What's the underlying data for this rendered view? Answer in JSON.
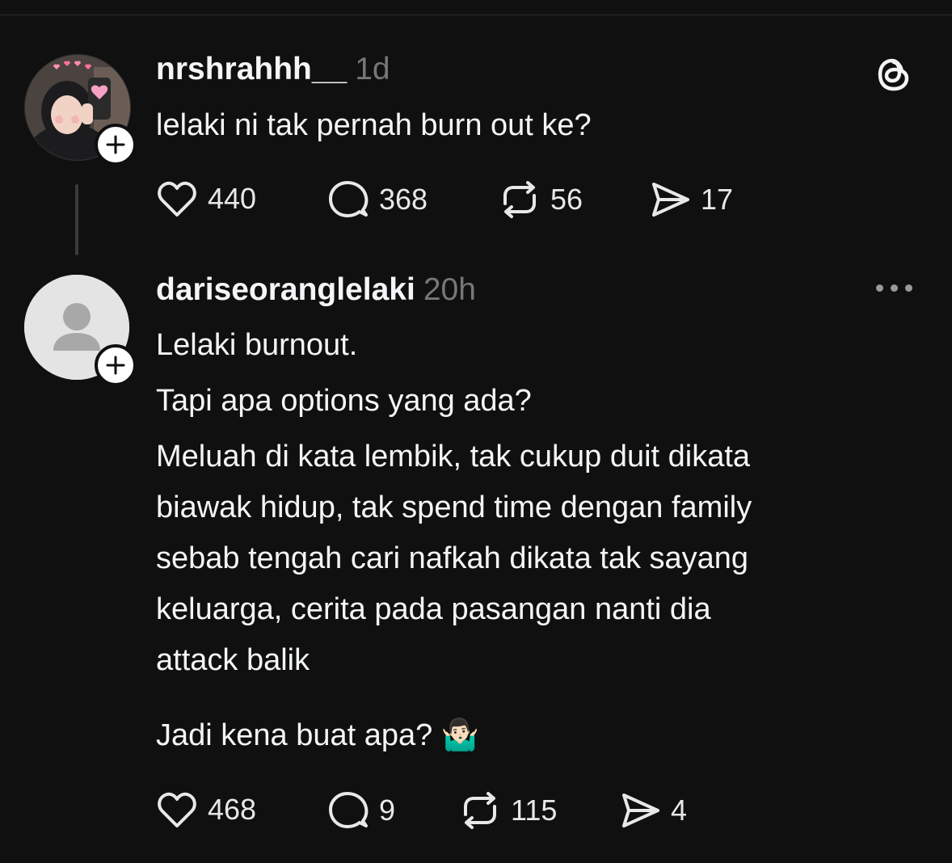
{
  "posts": [
    {
      "username": "nrshrahhh__",
      "time": "1d",
      "text": "lelaki ni tak pernah burn out ke?",
      "likes": "440",
      "replies": "368",
      "reposts": "56",
      "shares": "17"
    },
    {
      "username": "dariseoranglelaki",
      "time": "20h",
      "lines": [
        "Lelaki burnout.",
        "Tapi apa options yang ada?",
        "Meluah di kata lembik, tak cukup duit dikata",
        "biawak hidup, tak spend time dengan family",
        "sebab tengah cari nafkah dikata tak sayang",
        "keluarga, cerita pada pasangan nanti dia",
        "attack balik",
        "Jadi kena buat apa?"
      ],
      "emoji": "🤷🏻‍♂️",
      "likes": "468",
      "replies": "9",
      "reposts": "115",
      "shares": "4"
    }
  ],
  "icons": {
    "logo": "threads-logo-icon",
    "more": "more-options-icon",
    "like": "heart-icon",
    "reply": "comment-icon",
    "repost": "repost-icon",
    "share": "share-icon"
  },
  "colors": {
    "background": "#101010",
    "text": "#f3f5f7",
    "muted": "#777777"
  }
}
